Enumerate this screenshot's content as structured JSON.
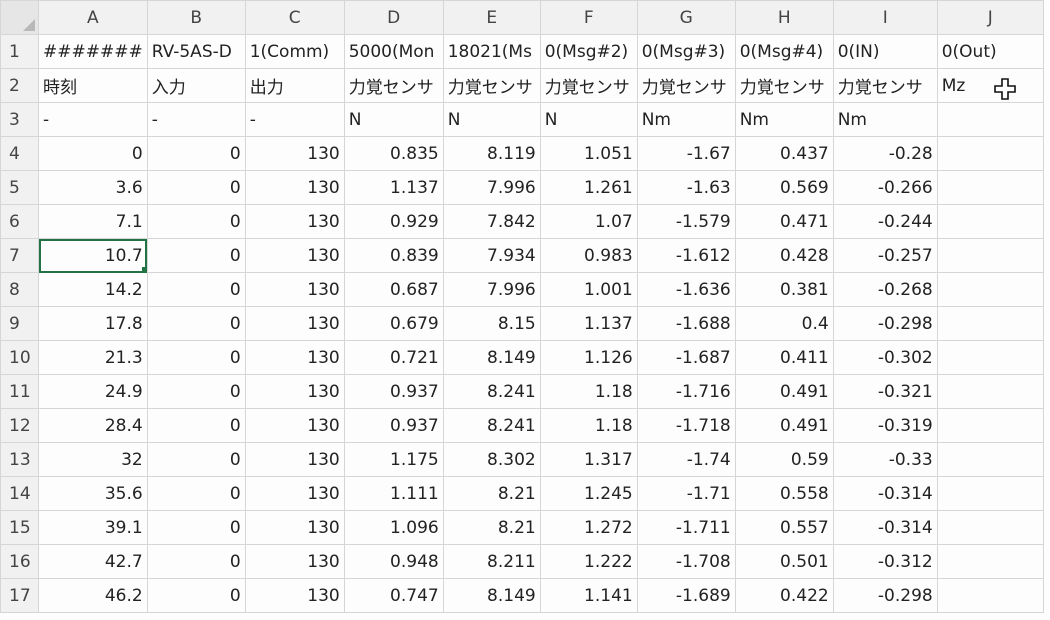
{
  "columns": [
    "A",
    "B",
    "C",
    "D",
    "E",
    "F",
    "G",
    "H",
    "I",
    "J"
  ],
  "rows": [
    {
      "num": "1",
      "cells": [
        {
          "v": "#######",
          "a": "txt"
        },
        {
          "v": "RV-5AS-D",
          "a": "txt"
        },
        {
          "v": "1(Comm)",
          "a": "txt"
        },
        {
          "v": "5000(Mon",
          "a": "txt"
        },
        {
          "v": "18021(Ms",
          "a": "txt"
        },
        {
          "v": "0(Msg#2)",
          "a": "txt"
        },
        {
          "v": "0(Msg#3)",
          "a": "txt"
        },
        {
          "v": "0(Msg#4)",
          "a": "txt"
        },
        {
          "v": "0(IN)",
          "a": "txt"
        },
        {
          "v": "0(Out)",
          "a": "txt"
        }
      ]
    },
    {
      "num": "2",
      "cells": [
        {
          "v": "時刻",
          "a": "txt"
        },
        {
          "v": "入力",
          "a": "txt"
        },
        {
          "v": "出力",
          "a": "txt"
        },
        {
          "v": "力覚センサ",
          "a": "txt"
        },
        {
          "v": "力覚センサ",
          "a": "txt"
        },
        {
          "v": "力覚センサ",
          "a": "txt"
        },
        {
          "v": "力覚センサ",
          "a": "txt"
        },
        {
          "v": "力覚センサ",
          "a": "txt"
        },
        {
          "v": "力覚センサ",
          "a": "txt"
        },
        {
          "v": "Mz",
          "a": "txt"
        }
      ]
    },
    {
      "num": "3",
      "cells": [
        {
          "v": "-",
          "a": "txt"
        },
        {
          "v": "-",
          "a": "txt"
        },
        {
          "v": "-",
          "a": "txt"
        },
        {
          "v": "N",
          "a": "txt"
        },
        {
          "v": "N",
          "a": "txt"
        },
        {
          "v": "N",
          "a": "txt"
        },
        {
          "v": "Nm",
          "a": "txt"
        },
        {
          "v": "Nm",
          "a": "txt"
        },
        {
          "v": "Nm",
          "a": "txt"
        },
        {
          "v": "",
          "a": "txt"
        }
      ]
    },
    {
      "num": "4",
      "cells": [
        {
          "v": "0"
        },
        {
          "v": "0"
        },
        {
          "v": "130"
        },
        {
          "v": "0.835"
        },
        {
          "v": "8.119"
        },
        {
          "v": "1.051"
        },
        {
          "v": "-1.67"
        },
        {
          "v": "0.437"
        },
        {
          "v": "-0.28"
        },
        {
          "v": ""
        }
      ]
    },
    {
      "num": "5",
      "cells": [
        {
          "v": "3.6"
        },
        {
          "v": "0"
        },
        {
          "v": "130"
        },
        {
          "v": "1.137"
        },
        {
          "v": "7.996"
        },
        {
          "v": "1.261"
        },
        {
          "v": "-1.63"
        },
        {
          "v": "0.569"
        },
        {
          "v": "-0.266"
        },
        {
          "v": ""
        }
      ]
    },
    {
      "num": "6",
      "cells": [
        {
          "v": "7.1"
        },
        {
          "v": "0"
        },
        {
          "v": "130"
        },
        {
          "v": "0.929"
        },
        {
          "v": "7.842"
        },
        {
          "v": "1.07"
        },
        {
          "v": "-1.579"
        },
        {
          "v": "0.471"
        },
        {
          "v": "-0.244"
        },
        {
          "v": ""
        }
      ]
    },
    {
      "num": "7",
      "cells": [
        {
          "v": "10.7",
          "sel": true
        },
        {
          "v": "0"
        },
        {
          "v": "130"
        },
        {
          "v": "0.839"
        },
        {
          "v": "7.934"
        },
        {
          "v": "0.983"
        },
        {
          "v": "-1.612"
        },
        {
          "v": "0.428"
        },
        {
          "v": "-0.257"
        },
        {
          "v": ""
        }
      ]
    },
    {
      "num": "8",
      "cells": [
        {
          "v": "14.2"
        },
        {
          "v": "0"
        },
        {
          "v": "130"
        },
        {
          "v": "0.687"
        },
        {
          "v": "7.996"
        },
        {
          "v": "1.001"
        },
        {
          "v": "-1.636"
        },
        {
          "v": "0.381"
        },
        {
          "v": "-0.268"
        },
        {
          "v": ""
        }
      ]
    },
    {
      "num": "9",
      "cells": [
        {
          "v": "17.8"
        },
        {
          "v": "0"
        },
        {
          "v": "130"
        },
        {
          "v": "0.679"
        },
        {
          "v": "8.15"
        },
        {
          "v": "1.137"
        },
        {
          "v": "-1.688"
        },
        {
          "v": "0.4"
        },
        {
          "v": "-0.298"
        },
        {
          "v": ""
        }
      ]
    },
    {
      "num": "10",
      "cells": [
        {
          "v": "21.3"
        },
        {
          "v": "0"
        },
        {
          "v": "130"
        },
        {
          "v": "0.721"
        },
        {
          "v": "8.149"
        },
        {
          "v": "1.126"
        },
        {
          "v": "-1.687"
        },
        {
          "v": "0.411"
        },
        {
          "v": "-0.302"
        },
        {
          "v": ""
        }
      ]
    },
    {
      "num": "11",
      "cells": [
        {
          "v": "24.9"
        },
        {
          "v": "0"
        },
        {
          "v": "130"
        },
        {
          "v": "0.937"
        },
        {
          "v": "8.241"
        },
        {
          "v": "1.18"
        },
        {
          "v": "-1.716"
        },
        {
          "v": "0.491"
        },
        {
          "v": "-0.321"
        },
        {
          "v": ""
        }
      ]
    },
    {
      "num": "12",
      "cells": [
        {
          "v": "28.4"
        },
        {
          "v": "0"
        },
        {
          "v": "130"
        },
        {
          "v": "0.937"
        },
        {
          "v": "8.241"
        },
        {
          "v": "1.18"
        },
        {
          "v": "-1.718"
        },
        {
          "v": "0.491"
        },
        {
          "v": "-0.319"
        },
        {
          "v": ""
        }
      ]
    },
    {
      "num": "13",
      "cells": [
        {
          "v": "32"
        },
        {
          "v": "0"
        },
        {
          "v": "130"
        },
        {
          "v": "1.175"
        },
        {
          "v": "8.302"
        },
        {
          "v": "1.317"
        },
        {
          "v": "-1.74"
        },
        {
          "v": "0.59"
        },
        {
          "v": "-0.33"
        },
        {
          "v": ""
        }
      ]
    },
    {
      "num": "14",
      "cells": [
        {
          "v": "35.6"
        },
        {
          "v": "0"
        },
        {
          "v": "130"
        },
        {
          "v": "1.111"
        },
        {
          "v": "8.21"
        },
        {
          "v": "1.245"
        },
        {
          "v": "-1.71"
        },
        {
          "v": "0.558"
        },
        {
          "v": "-0.314"
        },
        {
          "v": ""
        }
      ]
    },
    {
      "num": "15",
      "cells": [
        {
          "v": "39.1"
        },
        {
          "v": "0"
        },
        {
          "v": "130"
        },
        {
          "v": "1.096"
        },
        {
          "v": "8.21"
        },
        {
          "v": "1.272"
        },
        {
          "v": "-1.711"
        },
        {
          "v": "0.557"
        },
        {
          "v": "-0.314"
        },
        {
          "v": ""
        }
      ]
    },
    {
      "num": "16",
      "cells": [
        {
          "v": "42.7"
        },
        {
          "v": "0"
        },
        {
          "v": "130"
        },
        {
          "v": "0.948"
        },
        {
          "v": "8.211"
        },
        {
          "v": "1.222"
        },
        {
          "v": "-1.708"
        },
        {
          "v": "0.501"
        },
        {
          "v": "-0.312"
        },
        {
          "v": ""
        }
      ]
    },
    {
      "num": "17",
      "cells": [
        {
          "v": "46.2"
        },
        {
          "v": "0"
        },
        {
          "v": "130"
        },
        {
          "v": "0.747"
        },
        {
          "v": "8.149"
        },
        {
          "v": "1.141"
        },
        {
          "v": "-1.689"
        },
        {
          "v": "0.422"
        },
        {
          "v": "-0.298"
        },
        {
          "v": ""
        }
      ]
    }
  ],
  "selected_cell": "A7",
  "cursor_icon": "cell-select-cross-icon",
  "colors": {
    "selection": "#217346",
    "header_bg": "#f1f1f1",
    "grid": "#d6d6d6"
  }
}
